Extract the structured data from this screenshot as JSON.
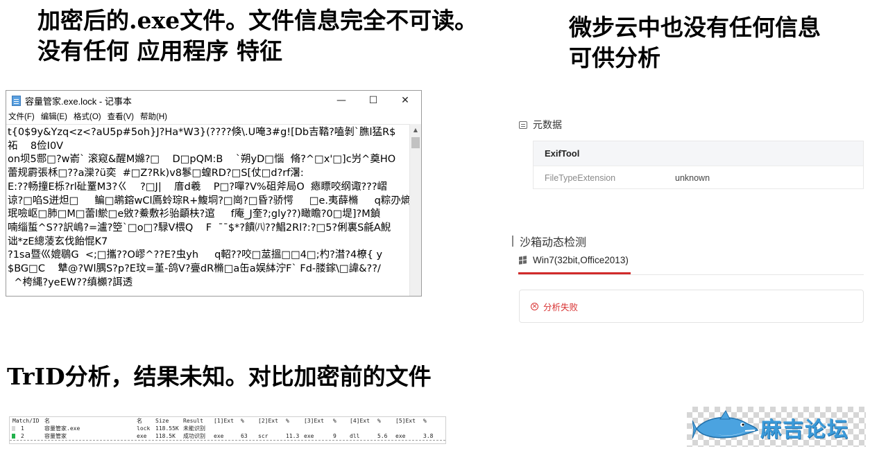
{
  "headings": {
    "left": [
      "加密后的.exe文件。文件信息完全不可读。",
      "没有任何  应用程序 特征"
    ],
    "right": [
      "微步云中也没有任何信息",
      "可供分析"
    ],
    "bottom": "TrID分析，结果未知。对比加密前的文件"
  },
  "notepad": {
    "title": "容量管家.exe.lock - 记事本",
    "controls": {
      "minimize": "—",
      "maximize": "☐",
      "close": "✕"
    },
    "menu": [
      "文件(F)",
      "编辑(E)",
      "格式(O)",
      "查看(V)",
      "帮助(H)"
    ],
    "lines": [
      "t{0$9y&Yzq<z<?aU5p#5oh}J?Ha*W3}(????倏\\.U唵3#g![Db吉鞜?嗑剝`膲l猛R$",
      "祏    8俭I0V",
      "on坝5郻□?w嵛` 滚窥&醒M嬵?□    D□pQM:B    `朔yD□惱  脩?^□x'□]c屶^奠HO",
      "蕾规霨張柇□??a灤?ü奕  #□Z?Rk)v8鬖□蝗RD?□S[仗□d?rf濐:",
      "E:??畅撞E栎?rl砋罿M3?ㄍ    ?□J|    庴d羲    P□?嘽?V%砠斧局O  瘱瞟咬纲诹???嶍",
      "谅?□啗S迸炟□     鳊□鹕鎔wCl鳫蛉琮R+鰒垌?□崗?□昏?骄愕     □e.夷薛樇     q粽刅熵",
      "珉噞岖□肺□M□蕾l鯲□e敓?鯗敷衫骀顲枎?逭     f庵_J奎?;gly??)瞰瞻?0□堤]?M鍞",
      "喃缁蜇^S??訳嶋?=瀘?箜`□o□?騄V椳Q    F  ¯¯$*?饋㈧??鯧2Rl?:?□5?俐裏S毹A鯢",
      "诎*zE總蓤玄伐飴惃K7",
      "?1sa暨巛媲鶡G  <;□攜??O嵺^??E?虫yh     q軺??咬□莁搵□□4□;杓?澘?4橑{ y",
      "$BG□C    犨@?Wl腢S?p?E玟=堇-鸽V?亹dR樇□a缶a娱絊泞F` Fd-𦝼鎵\\□諱&??/",
      "  ^桍縄?yeEW??缜櫇?誀透"
    ]
  },
  "metadata": {
    "section_title": "元数据",
    "tool": "ExifTool",
    "key": "FileTypeExtension",
    "value": "unknown"
  },
  "sandbox": {
    "section_title": "沙箱动态检测",
    "env_tab": "Win7(32bit,Office2013)",
    "fail_text": "分析失败",
    "fail_icon": "⊗"
  },
  "trid": {
    "headers": [
      "Match/ID",
      "名",
      "名",
      "Size",
      "Result",
      "[1]Ext",
      "%",
      "[2]Ext",
      "%",
      "[3]Ext",
      "%",
      "[4]Ext",
      "%",
      "[5]Ext",
      "%"
    ],
    "rows": [
      [
        "1",
        "容量管家.exe",
        "lock",
        "118.55K",
        "未能识别",
        "",
        "",
        "",
        "",
        "",
        "",
        "",
        "",
        "",
        ""
      ],
      [
        "2",
        "容量管家",
        "exe",
        "118.5K",
        "成功识别",
        "exe",
        "63",
        "scr",
        "11.3",
        "exe",
        "9",
        "dll",
        "5.6",
        "exe",
        "3.8"
      ]
    ]
  },
  "logo": {
    "text": "麻吉论坛"
  },
  "colors": {
    "accent_red": "#d12a2a",
    "fail_red": "#d83131",
    "trid_green": "#22b14c",
    "logo_blue": "#3b9ad9"
  }
}
